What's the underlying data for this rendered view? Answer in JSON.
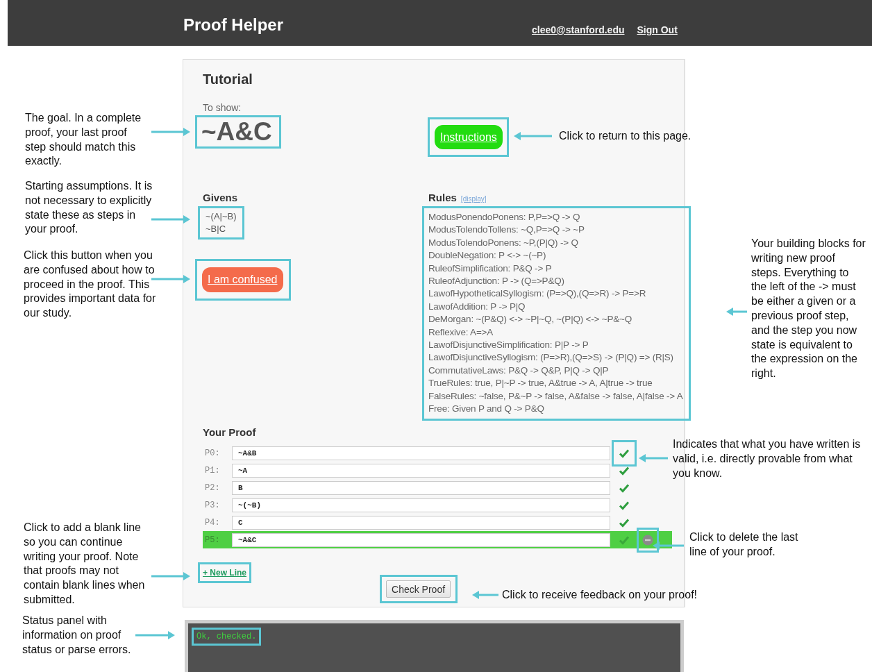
{
  "header": {
    "title": "Proof Helper",
    "links": [
      "clee0@stanford.edu",
      "Sign Out"
    ]
  },
  "panel": {
    "title": "Tutorial",
    "goal_label": "To show:",
    "goal": "~A&C",
    "instructions_button": "Instructions",
    "givens": {
      "title": "Givens",
      "items": [
        "~(A|~B)",
        "~B|C"
      ]
    },
    "confused_button": "I am confused",
    "rules": {
      "title": "Rules",
      "toggle": "[display]",
      "items": [
        "ModusPonendoPonens: P,P=>Q -> Q",
        "ModusTolendoTollens: ~Q,P=>Q -> ~P",
        "ModusTolendoPonens: ~P,(P|Q) -> Q",
        "DoubleNegation: P <-> ~(~P)",
        "RuleofSimplification: P&Q -> P",
        "RuleofAdjunction: P -> (Q=>P&Q)",
        "LawofHypotheticalSyllogism: (P=>Q),(Q=>R) -> P=>R",
        "LawofAddition: P -> P|Q",
        "DeMorgan: ~(P&Q) <-> ~P|~Q, ~(P|Q) <-> ~P&~Q",
        "Reflexive: A=>A",
        "LawofDisjunctiveSimplification: P|P -> P",
        "LawofDisjunctiveSyllogism: (P=>R),(Q=>S) -> (P|Q) => (R|S)",
        "CommutativeLaws: P&Q -> Q&P, P|Q -> Q|P",
        "TrueRules: true, P|~P -> true, A&true -> A, A|true -> true",
        "FalseRules: ~false, P&~P -> false, A&false -> false, A|false -> A",
        "Free: Given P and Q -> P&Q"
      ]
    },
    "proof": {
      "title": "Your Proof",
      "lines": [
        {
          "label": "P0:",
          "value": "~A&B",
          "valid": true,
          "selected": false
        },
        {
          "label": "P1:",
          "value": "~A",
          "valid": true,
          "selected": false
        },
        {
          "label": "P2:",
          "value": "B",
          "valid": true,
          "selected": false
        },
        {
          "label": "P3:",
          "value": "~(~B)",
          "valid": true,
          "selected": false
        },
        {
          "label": "P4:",
          "value": "C",
          "valid": true,
          "selected": false
        },
        {
          "label": "P5:",
          "value": "~A&C",
          "valid": true,
          "selected": true
        }
      ]
    },
    "new_line_link": "+ New Line",
    "check_button": "Check Proof"
  },
  "status": {
    "message": "Ok, checked."
  },
  "annotations": [
    "The goal. In a complete proof, your last proof step should match this exactly.",
    "Starting assumptions. It is not necessary to explicitly state these as steps in your proof.",
    "Click this button when you are confused about how to proceed in the proof. This provides important data for our study.",
    "Click to add a blank line so you can continue writing your proof. Note that proofs may not contain blank lines when submitted.",
    "Status panel with information on proof status or parse errors.",
    "Click to return to this page.",
    "Your building blocks for writing new proof steps. Everything to the left of the -> must be either a given or a previous proof step, and the step you now state is equivalent to the expression on the right.",
    "Indicates that what you have written is valid, i.e. directly provable from what you know.",
    "Click to delete the last line of your proof.",
    "Click to receive feedback on your proof!"
  ]
}
